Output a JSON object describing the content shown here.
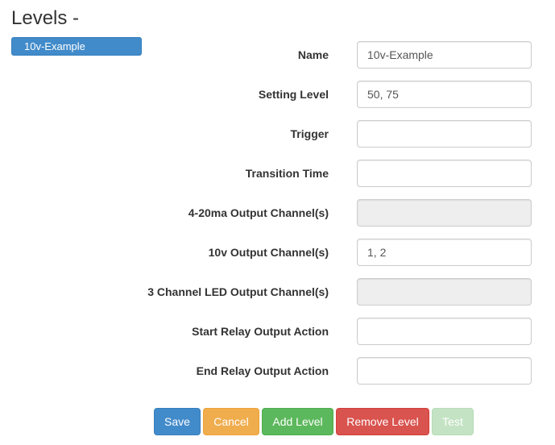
{
  "page": {
    "title": "Levels -"
  },
  "levels_list": [
    {
      "label": "10v-Example"
    }
  ],
  "form": {
    "fields": [
      {
        "label": "Name",
        "value": "10v-Example",
        "disabled": false
      },
      {
        "label": "Setting Level",
        "value": "50, 75",
        "disabled": false
      },
      {
        "label": "Trigger",
        "value": "",
        "disabled": false
      },
      {
        "label": "Transition Time",
        "value": "",
        "disabled": false
      },
      {
        "label": "4-20ma Output Channel(s)",
        "value": "",
        "disabled": true
      },
      {
        "label": "10v Output Channel(s)",
        "value": "1, 2",
        "disabled": false
      },
      {
        "label": "3 Channel LED Output Channel(s)",
        "value": "",
        "disabled": true
      },
      {
        "label": "Start Relay Output Action",
        "value": "",
        "disabled": false
      },
      {
        "label": "End Relay Output Action",
        "value": "",
        "disabled": false
      }
    ]
  },
  "buttons": {
    "save": "Save",
    "cancel": "Cancel",
    "add_level": "Add Level",
    "remove_level": "Remove Level",
    "test": "Test"
  },
  "colors": {
    "primary": "#428bca",
    "warning": "#f0ad4e",
    "success": "#5cb85c",
    "danger": "#d9534f",
    "success_disabled": "#c4e3c4"
  }
}
